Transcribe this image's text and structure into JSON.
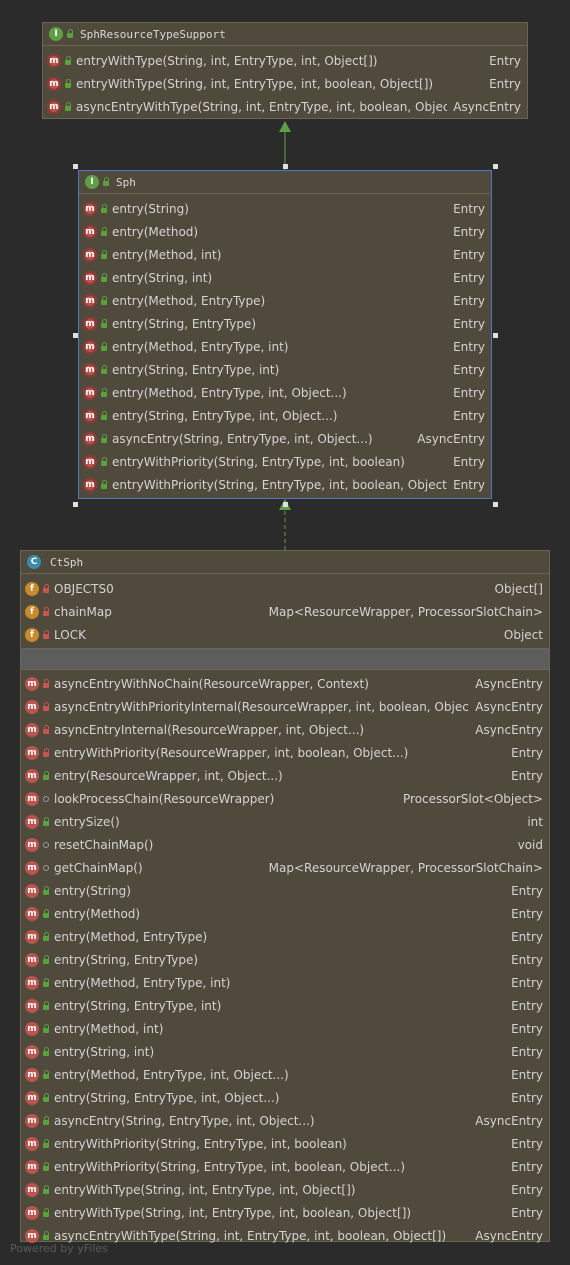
{
  "nodes": {
    "resource_type_support": {
      "title": "SphResourceTypeSupport",
      "kind_letter": "I",
      "members": [
        {
          "sig": "entryWithType(String, int, EntryType, int, Object[])",
          "type": "Entry"
        },
        {
          "sig": "entryWithType(String, int, EntryType, int, boolean, Object[])",
          "type": "Entry"
        },
        {
          "sig": "asyncEntryWithType(String, int, EntryType, int, boolean, Object[])",
          "type": "AsyncEntry"
        }
      ]
    },
    "sph": {
      "title": "Sph",
      "kind_letter": "I",
      "members": [
        {
          "sig": "entry(String)",
          "type": "Entry"
        },
        {
          "sig": "entry(Method)",
          "type": "Entry"
        },
        {
          "sig": "entry(Method, int)",
          "type": "Entry"
        },
        {
          "sig": "entry(String, int)",
          "type": "Entry"
        },
        {
          "sig": "entry(Method, EntryType)",
          "type": "Entry"
        },
        {
          "sig": "entry(String, EntryType)",
          "type": "Entry"
        },
        {
          "sig": "entry(Method, EntryType, int)",
          "type": "Entry"
        },
        {
          "sig": "entry(String, EntryType, int)",
          "type": "Entry"
        },
        {
          "sig": "entry(Method, EntryType, int, Object...)",
          "type": "Entry"
        },
        {
          "sig": "entry(String, EntryType, int, Object...)",
          "type": "Entry"
        },
        {
          "sig": "asyncEntry(String, EntryType, int, Object...)",
          "type": "AsyncEntry"
        },
        {
          "sig": "entryWithPriority(String, EntryType, int, boolean)",
          "type": "Entry"
        },
        {
          "sig": "entryWithPriority(String, EntryType, int, boolean, Object...)",
          "type": "Entry"
        }
      ]
    },
    "ctsph": {
      "title": "CtSph",
      "kind_letter": "C",
      "fields": [
        {
          "sig": "OBJECTS0",
          "type": "Object[]"
        },
        {
          "sig": "chainMap",
          "type": "Map<ResourceWrapper, ProcessorSlotChain>"
        },
        {
          "sig": "LOCK",
          "type": "Object"
        }
      ],
      "methods": [
        {
          "sig": "asyncEntryWithNoChain(ResourceWrapper, Context)",
          "type": "AsyncEntry",
          "vis": "priv"
        },
        {
          "sig": "asyncEntryWithPriorityInternal(ResourceWrapper, int, boolean, Object...)",
          "type": "AsyncEntry",
          "vis": "priv"
        },
        {
          "sig": "asyncEntryInternal(ResourceWrapper, int, Object...)",
          "type": "AsyncEntry",
          "vis": "priv"
        },
        {
          "sig": "entryWithPriority(ResourceWrapper, int, boolean, Object...)",
          "type": "Entry",
          "vis": "priv"
        },
        {
          "sig": "entry(ResourceWrapper, int, Object...)",
          "type": "Entry",
          "vis": "pub"
        },
        {
          "sig": "lookProcessChain(ResourceWrapper)",
          "type": "ProcessorSlot<Object>",
          "vis": "pkg"
        },
        {
          "sig": "entrySize()",
          "type": "int",
          "vis": "pub"
        },
        {
          "sig": "resetChainMap()",
          "type": "void",
          "vis": "pkg"
        },
        {
          "sig": "getChainMap()",
          "type": "Map<ResourceWrapper, ProcessorSlotChain>",
          "vis": "pkg"
        },
        {
          "sig": "entry(String)",
          "type": "Entry",
          "vis": "pub"
        },
        {
          "sig": "entry(Method)",
          "type": "Entry",
          "vis": "pub"
        },
        {
          "sig": "entry(Method, EntryType)",
          "type": "Entry",
          "vis": "pub"
        },
        {
          "sig": "entry(String, EntryType)",
          "type": "Entry",
          "vis": "pub"
        },
        {
          "sig": "entry(Method, EntryType, int)",
          "type": "Entry",
          "vis": "pub"
        },
        {
          "sig": "entry(String, EntryType, int)",
          "type": "Entry",
          "vis": "pub"
        },
        {
          "sig": "entry(Method, int)",
          "type": "Entry",
          "vis": "pub"
        },
        {
          "sig": "entry(String, int)",
          "type": "Entry",
          "vis": "pub"
        },
        {
          "sig": "entry(Method, EntryType, int, Object...)",
          "type": "Entry",
          "vis": "pub"
        },
        {
          "sig": "entry(String, EntryType, int, Object...)",
          "type": "Entry",
          "vis": "pub"
        },
        {
          "sig": "asyncEntry(String, EntryType, int, Object...)",
          "type": "AsyncEntry",
          "vis": "pub"
        },
        {
          "sig": "entryWithPriority(String, EntryType, int, boolean)",
          "type": "Entry",
          "vis": "pub"
        },
        {
          "sig": "entryWithPriority(String, EntryType, int, boolean, Object...)",
          "type": "Entry",
          "vis": "pub"
        },
        {
          "sig": "entryWithType(String, int, EntryType, int, Object[])",
          "type": "Entry",
          "vis": "pub"
        },
        {
          "sig": "entryWithType(String, int, EntryType, int, boolean, Object[])",
          "type": "Entry",
          "vis": "pub"
        },
        {
          "sig": "asyncEntryWithType(String, int, EntryType, int, boolean, Object[])",
          "type": "AsyncEntry",
          "vis": "pub"
        }
      ]
    }
  },
  "field_icon_letter": "f",
  "method_icon_letter": "m",
  "footer": "Powered by yFiles",
  "colors": {
    "background": "#2b2b2b",
    "node_fill": "#4f4a3c",
    "selection": "#4a78c2",
    "edge": "#5f9e47"
  }
}
